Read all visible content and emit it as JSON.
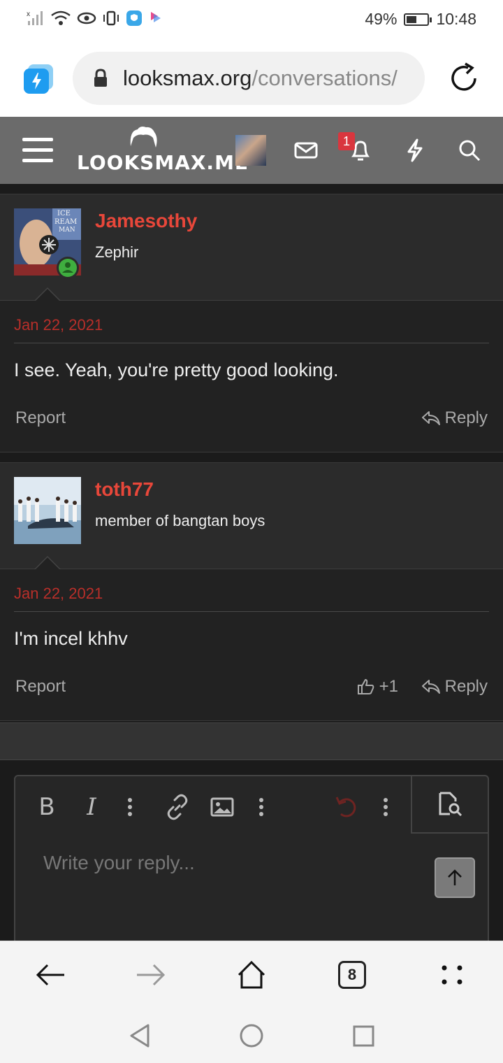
{
  "status_bar": {
    "battery_percent": "49%",
    "battery_level": 0.49,
    "time": "10:48"
  },
  "browser": {
    "url_domain": "looksmax.org",
    "url_path": "/conversations/",
    "tab_count": "8"
  },
  "site": {
    "logo_text": "LOOKSMAX.ME",
    "notification_count": "1"
  },
  "messages": [
    {
      "username": "Jamesothy",
      "user_title": "Zephir",
      "avatar_caption": "ICE CREAM MAN",
      "date": "Jan 22, 2021",
      "text": "I see. Yeah, you're pretty good looking.",
      "report_label": "Report",
      "reply_label": "Reply"
    },
    {
      "username": "toth77",
      "user_title": "member of bangtan boys",
      "date": "Jan 22, 2021",
      "text": "I'm incel khhv",
      "report_label": "Report",
      "like_count": "+1",
      "reply_label": "Reply"
    }
  ],
  "editor": {
    "placeholder": "Write your reply...",
    "bold_label": "B",
    "italic_label": "I"
  },
  "colors": {
    "accent_red": "#e8473a",
    "date_red": "#b82f2a",
    "header_gray": "#6b6b6b",
    "online_green": "#3fae3f"
  }
}
